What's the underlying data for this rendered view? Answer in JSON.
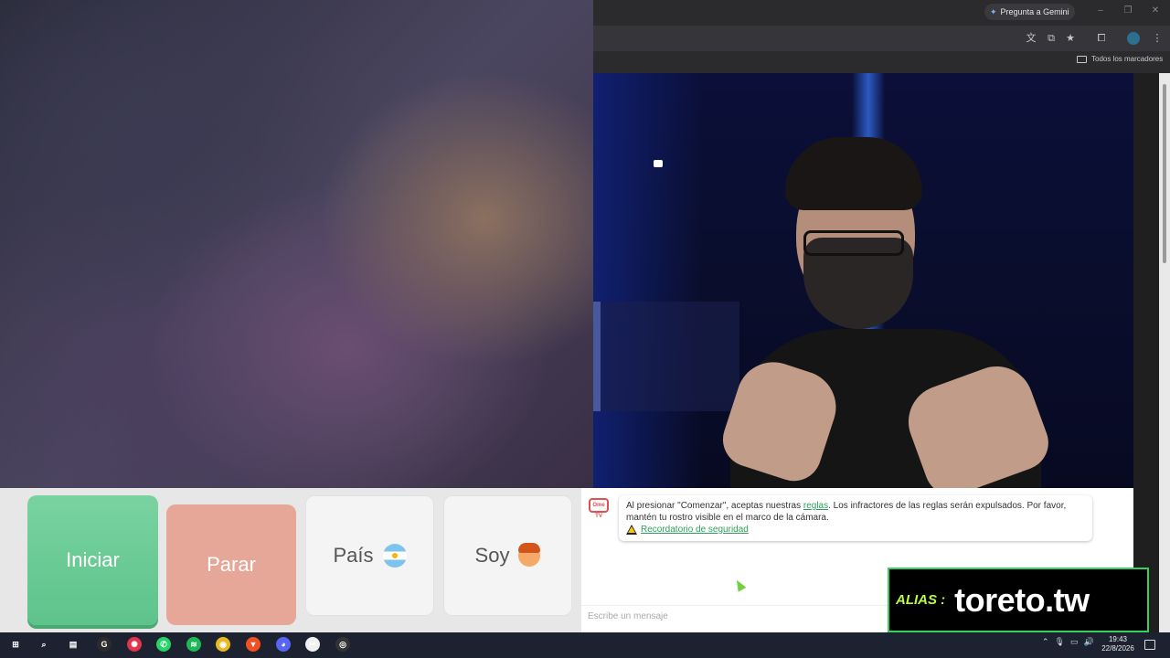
{
  "browser": {
    "gemini_label": "Pregunta a Gemini",
    "bookmarks_label": "Todos los marcadores",
    "window_controls": [
      "–",
      "❐",
      "✕"
    ],
    "toolbar_icons": [
      "translate-icon",
      "cast-icon",
      "star-icon",
      "extensions-icon",
      "profile-icon",
      "menu-icon"
    ]
  },
  "controls": {
    "start_label": "Iniciar",
    "stop_label": "Parar",
    "country_label": "País",
    "gender_label": "Soy"
  },
  "chat": {
    "logo_text": "Ome TV",
    "notice_before_link": "Al presionar \"Comenzar\", aceptas nuestras ",
    "notice_link": "reglas",
    "notice_after_link": ". Los infractores de las reglas serán expulsados. Por favor, mantén tu rostro visible en el marco de la cámara.",
    "safety_link": "Recordatorio de seguridad",
    "input_placeholder": "Escribe un mensaje"
  },
  "overlay": {
    "alias_label": "ALIAS :",
    "alias_value": "toreto.tw"
  },
  "taskbar": {
    "time": "19:43",
    "date": "22/8/2026",
    "apps": [
      {
        "name": "windows-start-icon",
        "glyph": "⊞",
        "color": "#1d2230"
      },
      {
        "name": "search-icon",
        "glyph": "⌕",
        "color": "#1d2230"
      },
      {
        "name": "task-view-icon",
        "glyph": "▤",
        "color": "#1d2230"
      },
      {
        "name": "app-g-icon",
        "glyph": "G",
        "color": "#2b2b2b"
      },
      {
        "name": "app-red-icon",
        "glyph": "✺",
        "color": "#e0334c"
      },
      {
        "name": "whatsapp-icon",
        "glyph": "✆",
        "color": "#25d366"
      },
      {
        "name": "spotify-icon",
        "glyph": "≋",
        "color": "#1db954"
      },
      {
        "name": "chrome-icon",
        "glyph": "◉",
        "color": "#e8b923"
      },
      {
        "name": "brave-icon",
        "glyph": "▼",
        "color": "#f25022"
      },
      {
        "name": "discord-icon",
        "glyph": "◕",
        "color": "#5865f2"
      },
      {
        "name": "capcut-icon",
        "glyph": "✂",
        "color": "#f0f0f0"
      },
      {
        "name": "obs-icon",
        "glyph": "◎",
        "color": "#333"
      }
    ]
  }
}
